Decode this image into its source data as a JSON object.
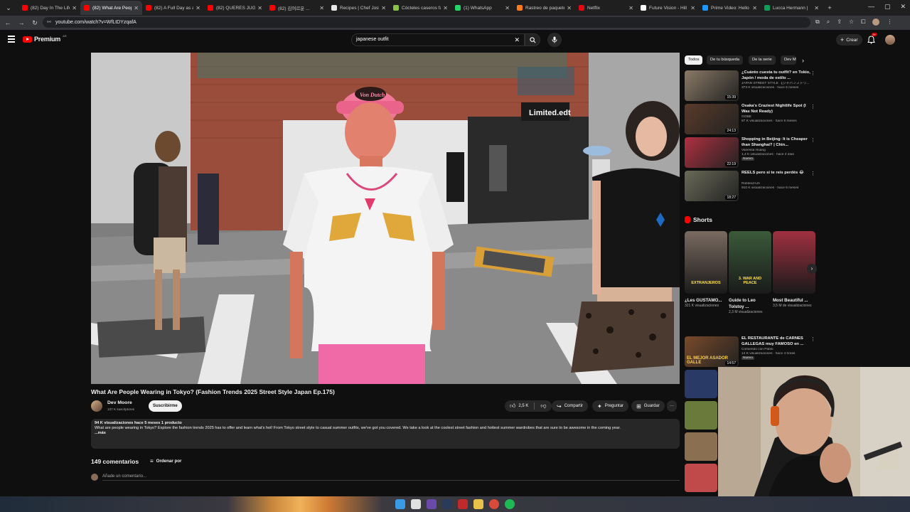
{
  "browser": {
    "tabs": [
      {
        "label": "(82) Day In The Life",
        "favicon_color": "#ff0000",
        "active": false
      },
      {
        "label": "(82) What Are People",
        "favicon_color": "#ff0000",
        "active": true
      },
      {
        "label": "(82) A Full Day as a",
        "favicon_color": "#ff0000",
        "active": false
      },
      {
        "label": "(82) QUERÉS JUGAR",
        "favicon_color": "#ff0000",
        "active": false
      },
      {
        "label": "(82) 김여르운 ...",
        "favicon_color": "#ff0000",
        "active": false
      },
      {
        "label": "Recipes | Chef Josh",
        "favicon_color": "#e8e8e8",
        "active": false
      },
      {
        "label": "Cócteles caseros fá",
        "favicon_color": "#8bc34a",
        "active": false
      },
      {
        "label": "(1) WhatsApp",
        "favicon_color": "#25d366",
        "active": false
      },
      {
        "label": "Rastreo de paquetes",
        "favicon_color": "#ff7a1a",
        "active": false
      },
      {
        "label": "Netflix",
        "favicon_color": "#e50914",
        "active": false
      },
      {
        "label": "Future Vision - Hill",
        "favicon_color": "#ffffff",
        "active": false
      },
      {
        "label": "Prime Video: Hello",
        "favicon_color": "#1a98ff",
        "active": false
      },
      {
        "label": "Lucca Hermann | ",
        "favicon_color": "#0f9d58",
        "active": false
      }
    ],
    "url": "youtube.com/watch?v=WfLtDYzqafA"
  },
  "youtube": {
    "logo_text": "Premium",
    "logo_badge": "AR",
    "search_value": "japanese outfit",
    "create_label": "Crear",
    "notif_count": "9+"
  },
  "video": {
    "title": "What Are People Wearing in Tokyo? (Fashion Trends 2025 Street Style Japan Ep.175)",
    "channel": "Dev Moore",
    "subscribers": "137 K suscriptores",
    "subscribe_label": "Suscribirme",
    "likes": "2,5 K",
    "share_label": "Compartir",
    "ask_label": "Preguntar",
    "save_label": "Guardar",
    "scene": {
      "cap_text": "Von Dutch",
      "shop_sign": "Limited.edt"
    }
  },
  "description": {
    "meta": "94 K visualizaciones  hace 5 meses  1 producto",
    "text": "What are people wearing in Tokyo? Explore the fashion trends 2025 has to offer and learn what's hot! From Tokyo street style to casual summer outfits, we've got you covered. We take a look at the coolest street fashion and hottest summer wardrobes that are sure to be awesome in the coming year.",
    "more": "...más"
  },
  "comments": {
    "count_label": "149 comentarios",
    "sort_label": "Ordenar por",
    "add_placeholder": "Añade un comentario..."
  },
  "sidebar": {
    "chips": [
      "Todos",
      "De tu búsqueda",
      "De la serie",
      "Dev M"
    ],
    "recommended": [
      {
        "title": "¿Cuánto cuesta tu outfit? en Tokio, Japón / moda de estilo ...",
        "channel": "JAPAN STREET STYLE 【ジャパンストリ...",
        "meta": "373 K visualizaciones · hace 6 meses",
        "duration": "15:39",
        "color": "#8a7a66"
      },
      {
        "title": "Osaka's Craziest Nightlife Spot (I Was Not Ready)",
        "channel": "GOBE",
        "meta": "87 K visualizaciones · hace 6 meses",
        "duration": "24:13",
        "color": "#5a3b2a"
      },
      {
        "title": "Shopping in Beijing: It is Cheaper than Shanghai? | Chin...",
        "channel": "Vanessa Huang",
        "meta": "1,4 K visualizaciones · hace 2 días",
        "badge": "Nuevo",
        "duration": "22:19",
        "color": "#b03040"
      },
      {
        "title": "REELS pero si te reís perdés 😂",
        "channel": "RoblesJAJA",
        "meta": "910 K visualizaciones · hace 6 meses",
        "duration": "18:27",
        "color": "#6a6a58"
      }
    ],
    "shorts_label": "Shorts",
    "shorts": [
      {
        "title": "¿Les GUSTAMO...",
        "views": "321 K visualizaciones",
        "overlay": "EXTRANJEROS",
        "color": "#7a6a60"
      },
      {
        "title": "Guide to Leo Tolstoy ...",
        "views": "2,3 M visualizaciones",
        "overlay": "3. WAR AND PEACE",
        "color": "#3a5a3a"
      },
      {
        "title": "Most Beautiful ...",
        "views": "3,5 M de visualizaciones",
        "overlay": "",
        "color": "#a03040"
      }
    ],
    "more_recommended": [
      {
        "title": "EL RESTAURANTE de CARNES GALLEGAS muy FAMOSO en ...",
        "channel": "Comiendo con Pablo",
        "meta": "14 K visualizaciones · hace 4 horas",
        "badge": "Nuevo",
        "duration": "14:57",
        "overlay": "EL MEJOR ASADOR GALLE",
        "color": "#7a4a2a"
      }
    ]
  },
  "colors": {
    "youtube_red": "#ff0000",
    "background": "#0f0f0f",
    "surface": "#272727",
    "text_secondary": "#aaaaaa"
  }
}
